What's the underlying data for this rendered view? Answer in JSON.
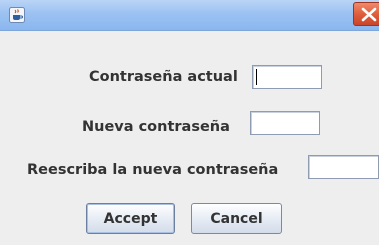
{
  "window": {
    "title_icon": "java-coffee-cup-icon",
    "close_icon": "close-x-icon",
    "close_color": "#dd5b39"
  },
  "form": {
    "current_password_label": "Contraseña actual",
    "current_password_value": "",
    "new_password_label": "Nueva contraseña",
    "new_password_value": "",
    "repeat_password_label": "Reescriba la nueva contraseña",
    "repeat_password_value": ""
  },
  "buttons": {
    "accept_label": "Accept",
    "cancel_label": "Cancel"
  }
}
